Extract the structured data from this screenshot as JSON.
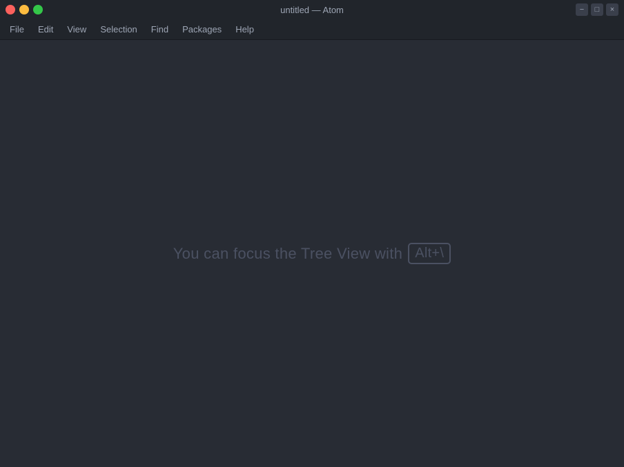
{
  "titleBar": {
    "title": "untitled — Atom",
    "controls": {
      "close": "close",
      "minimize": "minimize",
      "maximize": "maximize"
    },
    "rightControls": [
      "−",
      "□",
      "×"
    ]
  },
  "menuBar": {
    "items": [
      {
        "label": "File",
        "id": "file"
      },
      {
        "label": "Edit",
        "id": "edit"
      },
      {
        "label": "View",
        "id": "view"
      },
      {
        "label": "Selection",
        "id": "selection"
      },
      {
        "label": "Find",
        "id": "find"
      },
      {
        "label": "Packages",
        "id": "packages"
      },
      {
        "label": "Help",
        "id": "help"
      }
    ]
  },
  "mainContent": {
    "hintTextBefore": "You can focus the Tree View with ",
    "hintShortcut": "Alt+\\",
    "hintTextAfter": ""
  }
}
